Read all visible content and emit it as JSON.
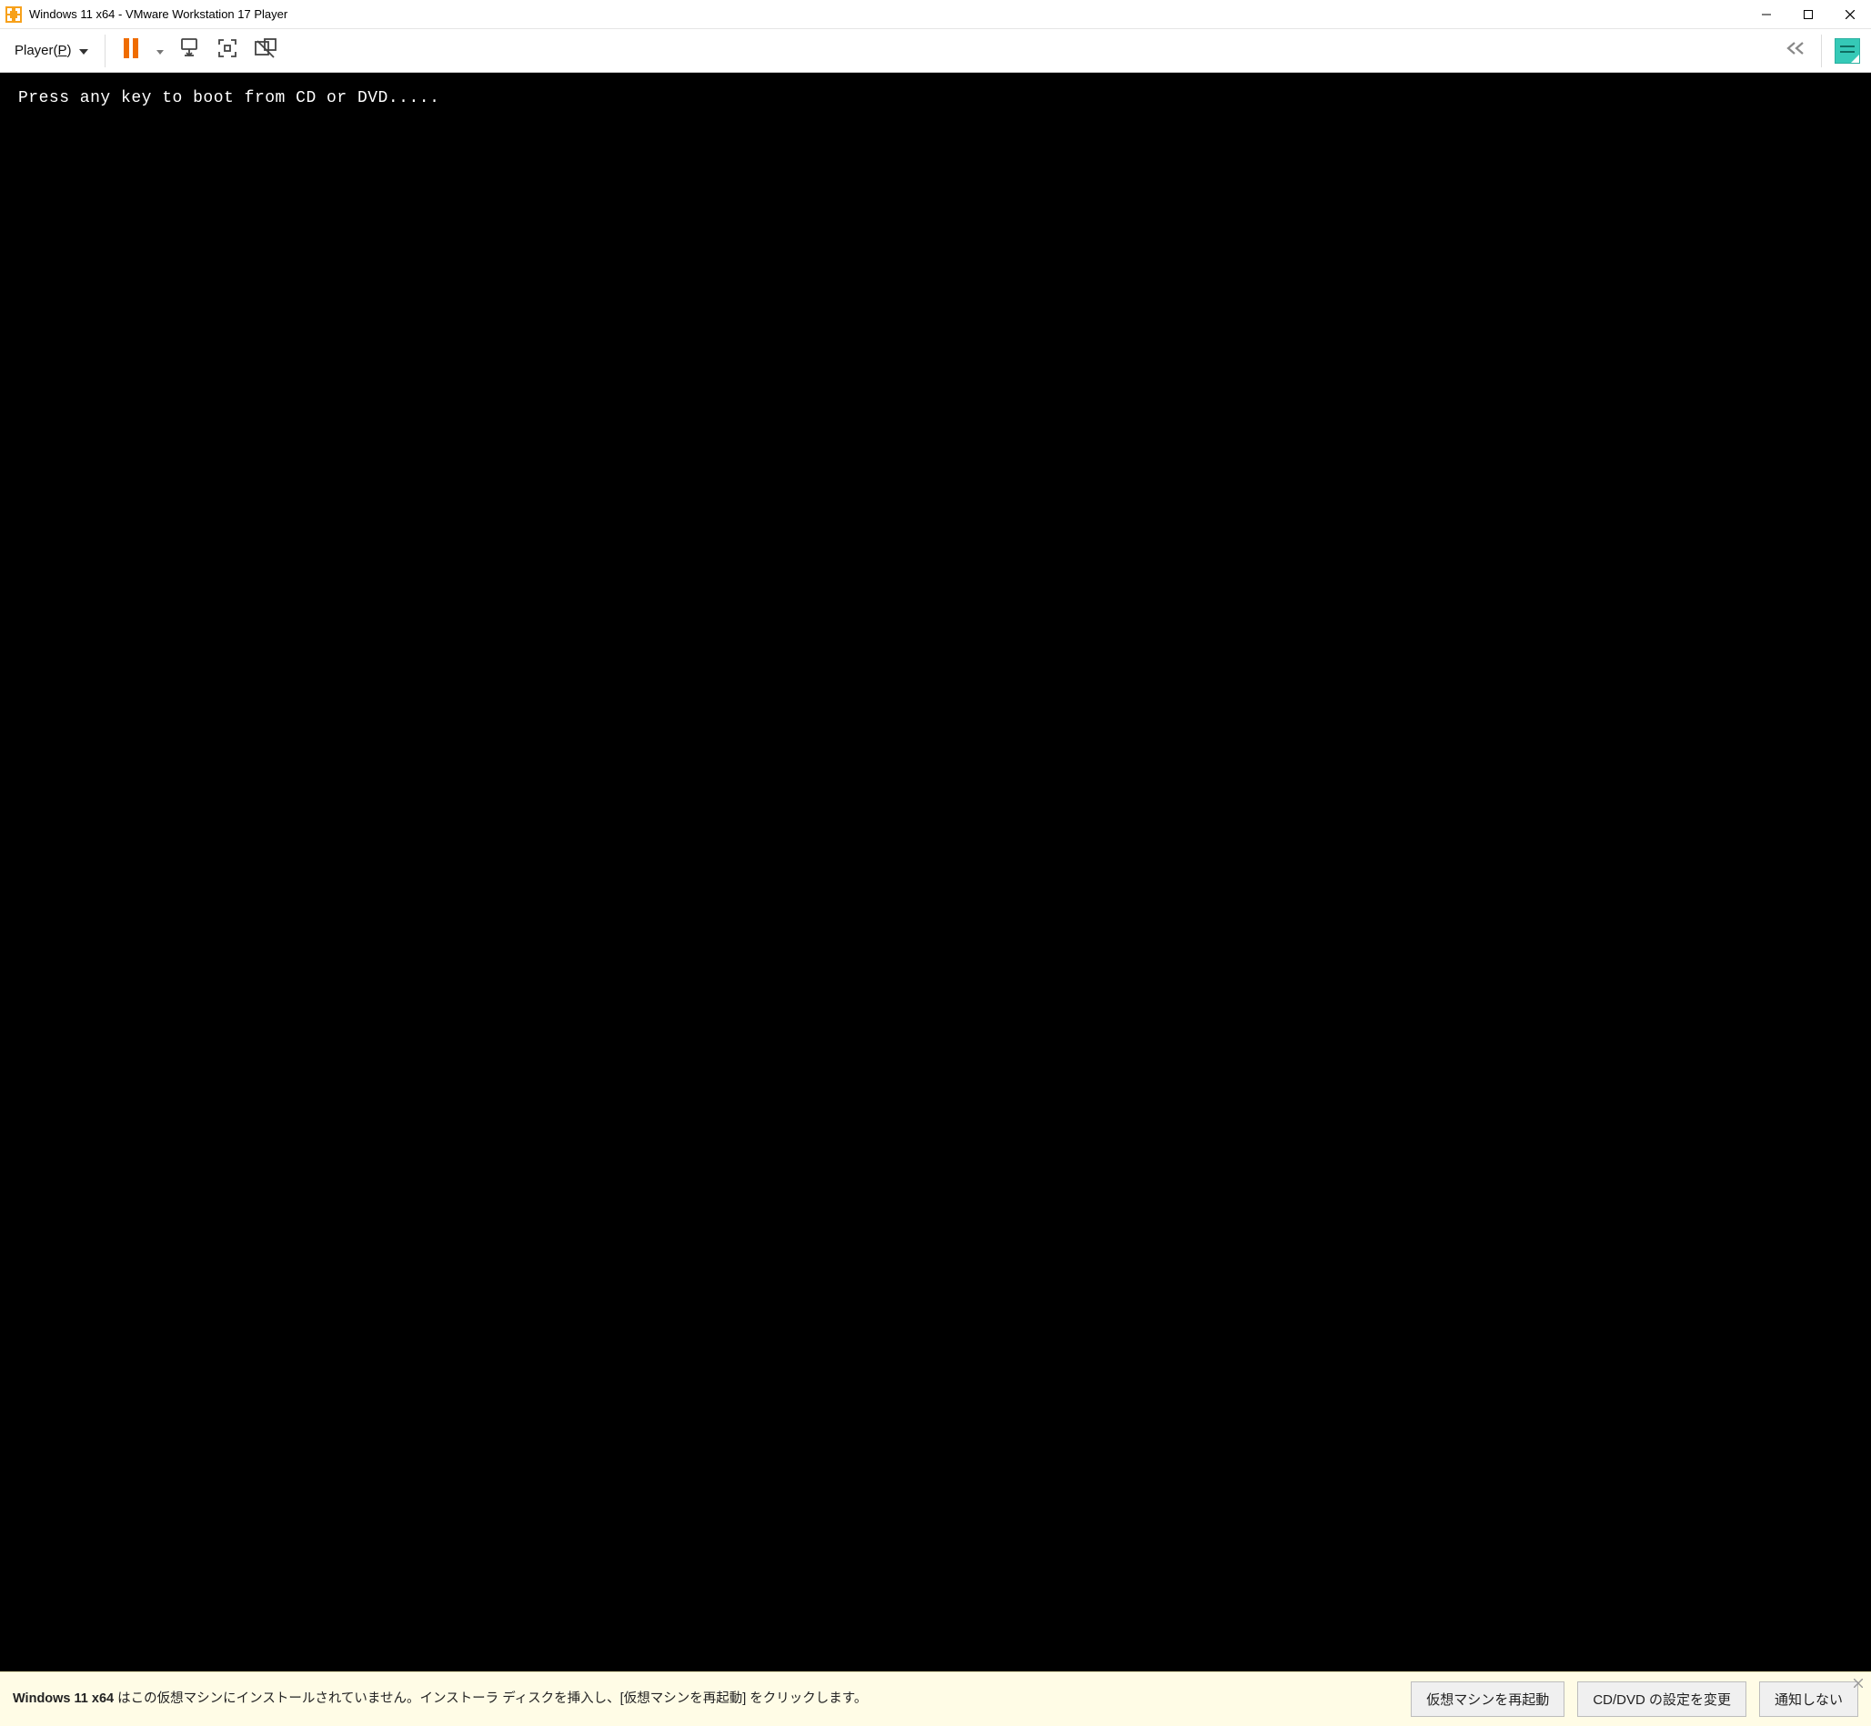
{
  "titlebar": {
    "title": "Windows 11 x64 - VMware Workstation 17 Player"
  },
  "toolbar": {
    "player_menu_prefix": "Player(",
    "player_menu_underline": "P",
    "player_menu_suffix": ")"
  },
  "console": {
    "text": "Press any key to boot from CD or DVD....."
  },
  "notification": {
    "vm_name": "Windows 11 x64",
    "message_rest": " はこの仮想マシンにインストールされていません。インストーラ ディスクを挿入し、[仮想マシンを再起動] をクリックします。",
    "btn_restart": "仮想マシンを再起動",
    "btn_cddvd": "CD/DVD の設定を変更",
    "btn_dismiss": "通知しない"
  }
}
